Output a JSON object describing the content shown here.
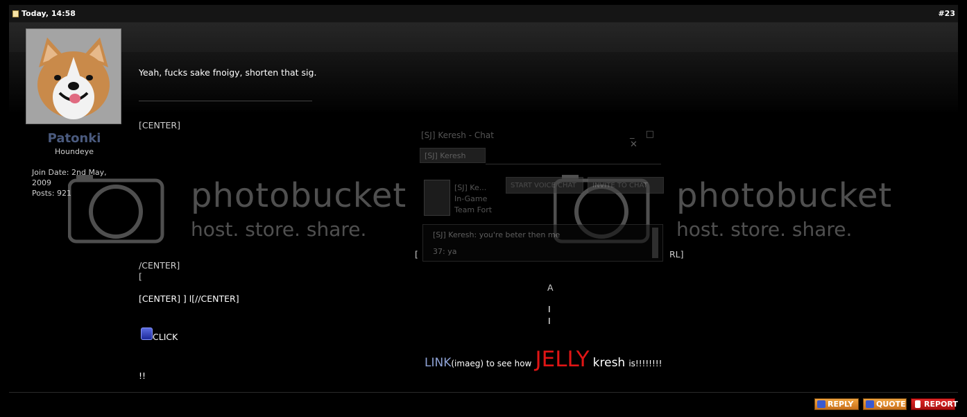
{
  "header": {
    "date": "Today, 14:58",
    "post_number": "#23"
  },
  "user": {
    "name": "Patonki",
    "title": "Houndeye",
    "join_date": "Join Date: 2nd May, 2009",
    "posts": "Posts: 921"
  },
  "post": {
    "message": "Yeah, fucks sake fnoigy, shorten that sig.",
    "sig_center_open": "[CENTER]",
    "sig_center_close": "/CENTER]",
    "sig_bracket": "[",
    "sig_bracket_right": "[",
    "sig_rl": "RL]",
    "sig_center_line": "[CENTER] ] l[//CENTER]",
    "click": "CLICK",
    "bang": "!!",
    "a_char": "A",
    "pipe1": "I",
    "pipe2": "I",
    "link": "LINK",
    "imaeg": "(imaeg) to see how",
    "jelly": "JELLY",
    "kresh": "kresh",
    "is": "is!!!!!!!!"
  },
  "watermark": {
    "word1": "photobucket",
    "word2": "host. store. share."
  },
  "chat_image": {
    "title": "[SJ] Keresh - Chat",
    "tab": "[SJ] Keresh",
    "user_name": "[SJ] Ke...",
    "user_status": "In-Game",
    "user_game": "Team Fort",
    "btn_voice": "START VOICE CHAT",
    "btn_invite": "INVITE TO CHAT",
    "line1": "[SJ] Keresh: you're beter then me",
    "line2": "37: ya"
  },
  "buttons": {
    "reply": "REPLY",
    "quote": "QUOTE",
    "report": "REPORT"
  },
  "colors": {
    "accent_orange": "#e0902e",
    "report_red": "#c81a1a",
    "username": "#4a5a7e",
    "jelly": "#e01515",
    "link": "#8fa3d6"
  }
}
